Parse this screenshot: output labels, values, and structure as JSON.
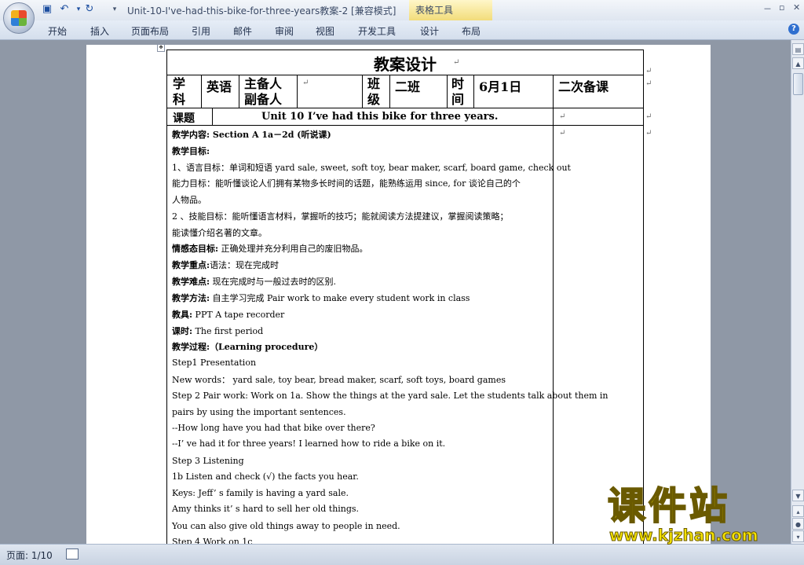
{
  "window": {
    "title": "Unit-10-I've-had-this-bike-for-three-years教案-2 [兼容模式]",
    "context_tab": "表格工具",
    "min": "－",
    "restore": "▫",
    "close": "✕"
  },
  "ribbon": {
    "tabs": [
      "开始",
      "插入",
      "页面布局",
      "引用",
      "邮件",
      "审阅",
      "视图",
      "开发工具",
      "设计",
      "布局"
    ],
    "help": "?"
  },
  "statusbar": {
    "page": "页面: 1/10"
  },
  "doc": {
    "header": "教案设计",
    "row1": {
      "subject_label": "学科",
      "subject": "英语",
      "prep_label": "主备人副备人",
      "class_label": "班级",
      "class": "二班",
      "time_label": "时间",
      "date": "6月1日",
      "secondary": "二次备课"
    },
    "row2": {
      "topic_label": "课题",
      "topic": "Unit 10    I’ve    had this bike for three years."
    },
    "lines": [
      {
        "label": "教学内容:",
        "text": "   Section A 1a－2d   (听说课)"
      },
      {
        "label": "教学目标:",
        "text": ""
      },
      {
        "label": "",
        "text": "  1、语言目标：单词和短语 yard sale, sweet, soft toy, bear maker, scarf, board game, check out"
      },
      {
        "label": "",
        "text": "能力目标：能听懂谈论人们拥有某物多长时间的话题，能熟练运用 since,  for  谈论自己的个"
      },
      {
        "label": "",
        "text": "人物品。"
      },
      {
        "label": "",
        "text": "  2 、技能目标：能听懂语言材料，掌握听的技巧；能就阅读方法提建议，掌握阅读策略；"
      },
      {
        "label": "",
        "text": "能读懂介绍名著的文章。"
      },
      {
        "label": "情感态目标:",
        "text": " 正确处理并充分利用自己的废旧物品。"
      },
      {
        "label": "教学重点:",
        "text": "语法：现在完成时"
      },
      {
        "label": "教学难点:",
        "text": " 现在完成时与一般过去时的区别."
      },
      {
        "label": "教学方法:",
        "text": " 自主学习完成 Pair work to make every student work in class"
      },
      {
        "label": "教具:",
        "text": "  PPT         A tape recorder"
      },
      {
        "label": "课时:",
        "text": " The first period"
      },
      {
        "label": "教学过程:",
        "text": "（Learning procedure）"
      },
      {
        "label": "",
        "text": "Step1 Presentation"
      },
      {
        "label": "",
        "text": "New words： yard sale, toy bear, bread maker, scarf, soft toys, board games"
      },
      {
        "label": "",
        "text": "Step 2 Pair work: Work on 1a. Show the things at the yard sale. Let the students talk about them in"
      },
      {
        "label": "",
        "text": "pairs by using the important sentences."
      },
      {
        "label": "",
        "text": "  --How long have you had that bike over there?"
      },
      {
        "label": "",
        "text": "  --I’ ve had it for three years! I learned how to ride a bike on it."
      },
      {
        "label": "",
        "text": "Step 3 Listening"
      },
      {
        "label": "",
        "text": "1b Listen and check (√) the facts you hear."
      },
      {
        "label": "",
        "text": "Keys: Jeff’ s family is having a yard sale."
      },
      {
        "label": "",
        "text": "    Amy thinks it’ s hard to sell her old things."
      },
      {
        "label": "",
        "text": "  You can also give old things away to people in need."
      },
      {
        "label": "",
        "text": "Step 4 Work on 1c"
      }
    ]
  },
  "watermark": {
    "title": "课件站",
    "url": "www.kjzhan.com"
  }
}
